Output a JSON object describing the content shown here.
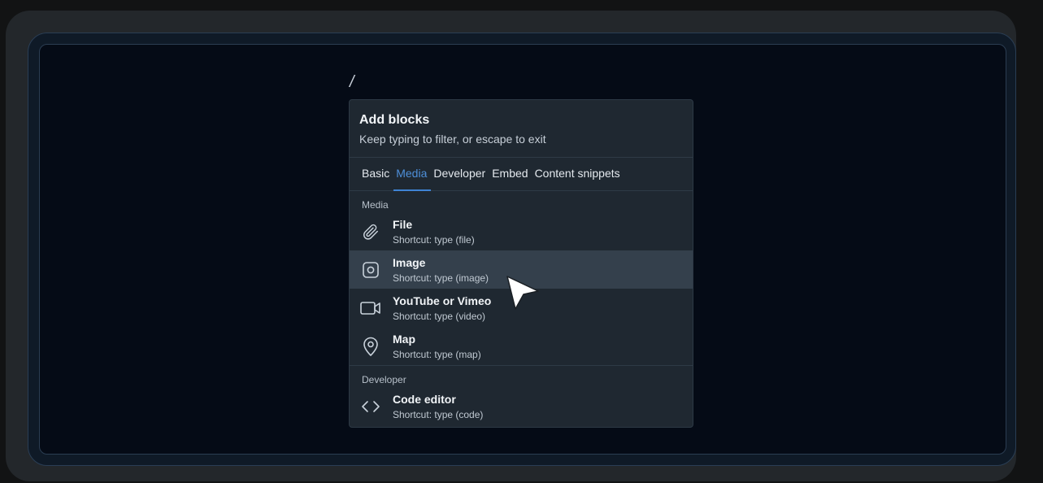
{
  "editor": {
    "typed_text": "/"
  },
  "popup": {
    "title": "Add blocks",
    "subtitle": "Keep typing to filter, or escape to exit",
    "tabs": [
      {
        "label": "Basic",
        "active": false
      },
      {
        "label": "Media",
        "active": true
      },
      {
        "label": "Developer",
        "active": false
      },
      {
        "label": "Embed",
        "active": false
      },
      {
        "label": "Content snippets",
        "active": false
      }
    ],
    "sections": [
      {
        "label": "Media",
        "items": [
          {
            "title": "File",
            "shortcut": "Shortcut: type (file)",
            "icon": "paperclip-icon"
          },
          {
            "title": "Image",
            "shortcut": "Shortcut: type (image)",
            "icon": "image-icon",
            "hovered": true
          },
          {
            "title": "YouTube or Vimeo",
            "shortcut": "Shortcut: type (video)",
            "icon": "video-icon"
          },
          {
            "title": "Map",
            "shortcut": "Shortcut: type (map)",
            "icon": "map-pin-icon"
          }
        ]
      },
      {
        "label": "Developer",
        "items": [
          {
            "title": "Code editor",
            "shortcut": "Shortcut: type (code)",
            "icon": "code-icon"
          }
        ]
      }
    ]
  },
  "colors": {
    "accent": "#4e8fd9",
    "popup_bg": "#1f2831",
    "hover_bg": "#34404c",
    "canvas_bg": "#050b16"
  }
}
